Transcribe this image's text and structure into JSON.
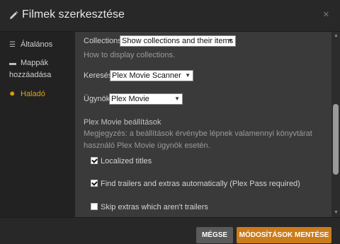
{
  "window": {
    "title": "Filmek szerkesztése",
    "close_glyph": "×"
  },
  "sidebar": {
    "items": [
      {
        "label": "Általános",
        "icon": "sliders-icon"
      },
      {
        "label": "Mappák hozzáadása",
        "icon": "folder-icon"
      },
      {
        "label": "Haladó",
        "icon": "gear-icon",
        "active": true
      }
    ]
  },
  "settings": {
    "collections": {
      "label": "Collections",
      "value": "Show collections and their items",
      "help": "How to display collections."
    },
    "scanner": {
      "label": "Keresés",
      "value": "Plex Movie Scanner"
    },
    "agent": {
      "label": "Ügynök",
      "value": "Plex Movie"
    },
    "agent_settings": {
      "heading": "Plex Movie beállítások",
      "note": "Megjegyzés: a beállítások érvénybe lépnek valamennyi könyvtárat használó Plex Movie ügynök esetén."
    },
    "checkboxes": [
      {
        "label": "Localized titles",
        "checked": true
      },
      {
        "label": "Find trailers and extras automatically (Plex Pass required)",
        "checked": true
      },
      {
        "label": "Skip extras which aren't trailers",
        "checked": false
      }
    ]
  },
  "footer": {
    "cancel_label": "MÉGSE",
    "save_label": "MÓDOSÍTÁSOK MENTÉSE"
  },
  "colors": {
    "accent": "#e5a00d",
    "save_button": "#cc7b19",
    "header_bg": "#282828",
    "content_bg": "#3a3a3a"
  }
}
